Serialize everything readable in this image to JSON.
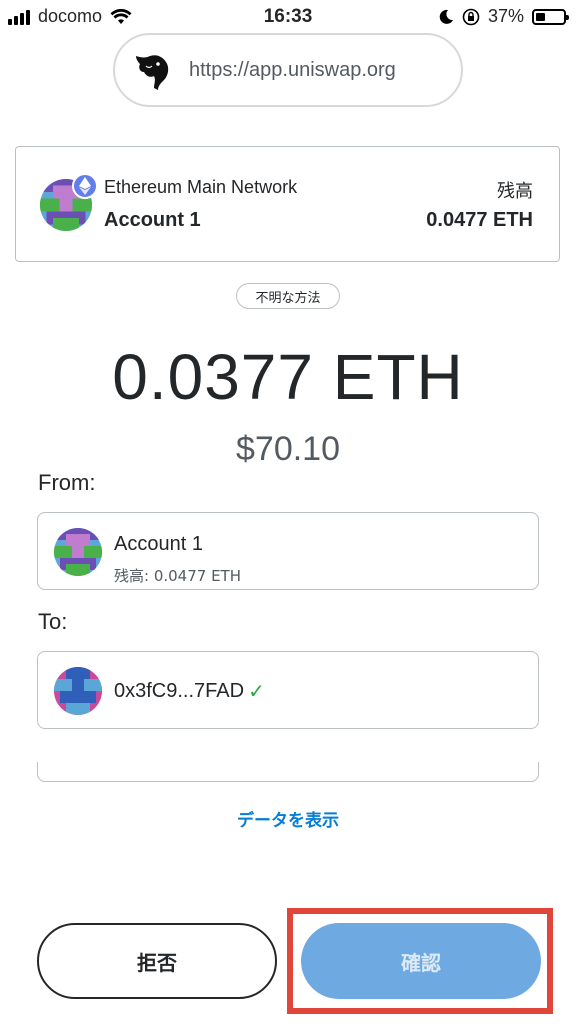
{
  "status_bar": {
    "carrier": "docomo",
    "time": "16:33",
    "battery": "37%",
    "battery_level": 0.37
  },
  "origin": {
    "url": "https://app.uniswap.org",
    "logo_icon": "uniswap-unicorn-icon"
  },
  "account_card": {
    "network": "Ethereum Main Network",
    "account_name": "Account 1",
    "balance_label": "残高",
    "balance_value": "0.0477 ETH"
  },
  "method_label": "不明な方法",
  "amount": "0.0377 ETH",
  "fiat_amount": "$70.10",
  "from": {
    "label": "From:",
    "name": "Account 1",
    "balance": "残高: 0.0477 ETH"
  },
  "to": {
    "label": "To:",
    "address": "0x3fC9...7FAD",
    "check": "✓"
  },
  "show_data_link": "データを表示",
  "buttons": {
    "reject": "拒否",
    "confirm": "確認"
  },
  "colors": {
    "link": "#037dd6",
    "confirm_bg": "#6fa9e1",
    "highlight": "#e0463a",
    "check": "#28a745"
  }
}
